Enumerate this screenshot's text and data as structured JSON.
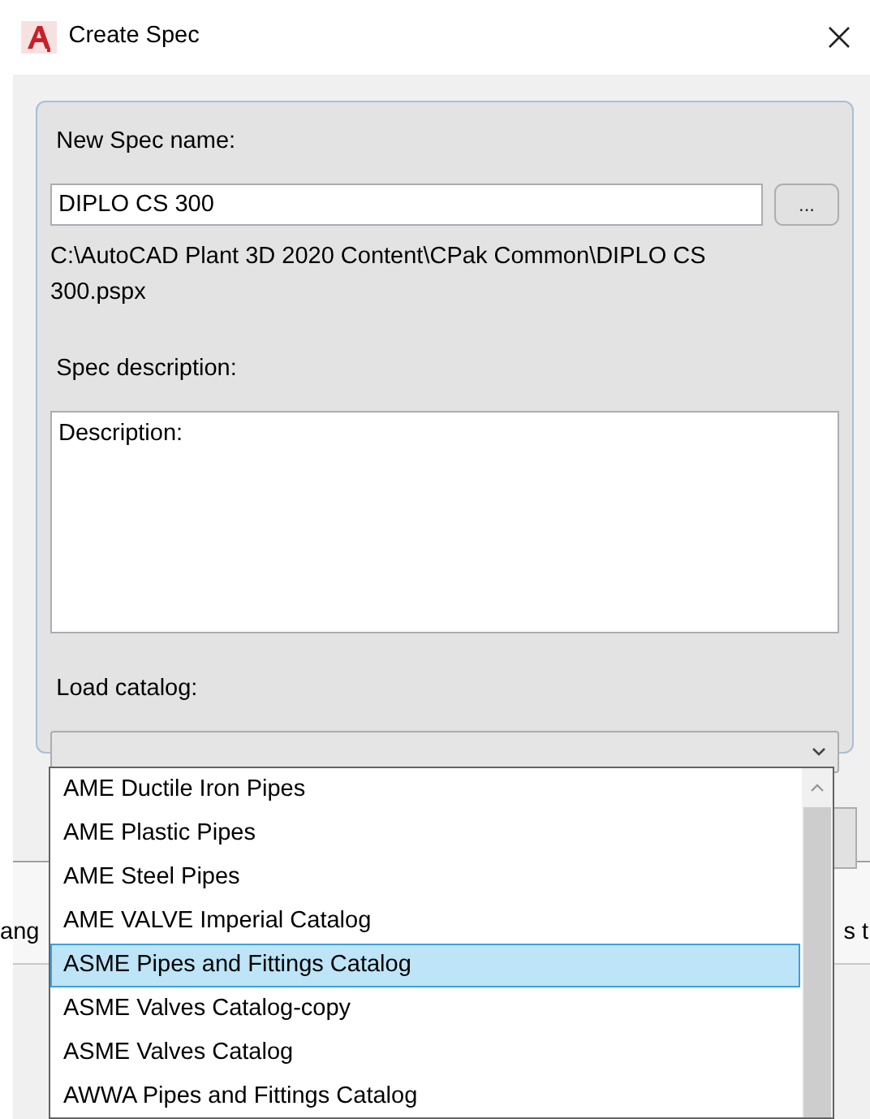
{
  "window": {
    "title": "Create Spec"
  },
  "spec_name": {
    "label": "New Spec name:",
    "value": "DIPLO CS 300",
    "browse_button": "..."
  },
  "path": "C:\\AutoCAD Plant 3D 2020 Content\\CPak Common\\DIPLO CS 300.pspx",
  "description": {
    "label": "Spec description:",
    "value": "Description:"
  },
  "catalog": {
    "label": "Load catalog:",
    "expanded": true,
    "options": [
      {
        "label": "AME Ductile Iron Pipes",
        "selected": false
      },
      {
        "label": "AME Plastic Pipes",
        "selected": false
      },
      {
        "label": "AME Steel Pipes",
        "selected": false
      },
      {
        "label": "AME VALVE Imperial Catalog",
        "selected": false
      },
      {
        "label": "ASME Pipes and Fittings Catalog",
        "selected": true
      },
      {
        "label": "ASME Valves Catalog-copy",
        "selected": false
      },
      {
        "label": "ASME Valves Catalog",
        "selected": false
      },
      {
        "label": "AWWA Pipes and Fittings Catalog",
        "selected": false
      }
    ]
  },
  "background_texts": [
    "ang",
    "s t"
  ]
}
